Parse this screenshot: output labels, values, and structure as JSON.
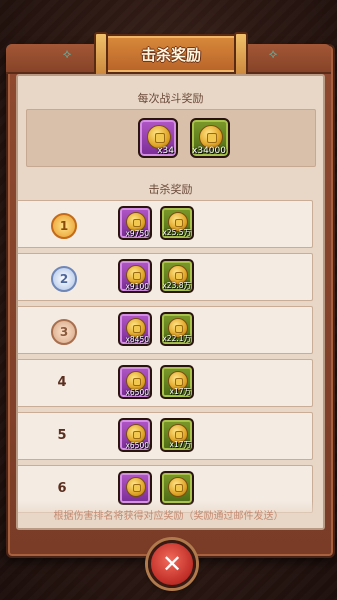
{
  "title": "击杀奖励",
  "per_battle": {
    "label": "每次战斗奖励",
    "items": [
      {
        "type": "purple",
        "icon": "gold-coin-icon",
        "qty": "x34"
      },
      {
        "type": "green",
        "icon": "copper-coin-icon",
        "qty": "x34000"
      }
    ]
  },
  "kill_rewards": {
    "label": "击杀奖励",
    "rows": [
      {
        "rank": "1",
        "badge": "gold",
        "items": [
          {
            "qty": "x9750"
          },
          {
            "qty": "x25.5万"
          }
        ]
      },
      {
        "rank": "2",
        "badge": "silver",
        "items": [
          {
            "qty": "x9100"
          },
          {
            "qty": "x23.8万"
          }
        ]
      },
      {
        "rank": "3",
        "badge": "bronze",
        "items": [
          {
            "qty": "x8450"
          },
          {
            "qty": "x22.1万"
          }
        ]
      },
      {
        "rank": "4",
        "badge": "",
        "items": [
          {
            "qty": "x6500"
          },
          {
            "qty": "x17万"
          }
        ]
      },
      {
        "rank": "5",
        "badge": "",
        "items": [
          {
            "qty": "x6500"
          },
          {
            "qty": "x17万"
          }
        ]
      },
      {
        "rank": "6",
        "badge": "",
        "items": [
          {
            "qty": ""
          },
          {
            "qty": ""
          }
        ]
      }
    ]
  },
  "footer": "根据伤害排名将获得对应奖励（奖励通过邮件发送）",
  "close_button": {
    "icon": "close-icon",
    "glyph": "✕"
  },
  "colors": {
    "frame": "#8f4a30",
    "parchment": "#e8d7c6",
    "title_plaque": "#d98a3a",
    "close_button": "#d13d33"
  }
}
